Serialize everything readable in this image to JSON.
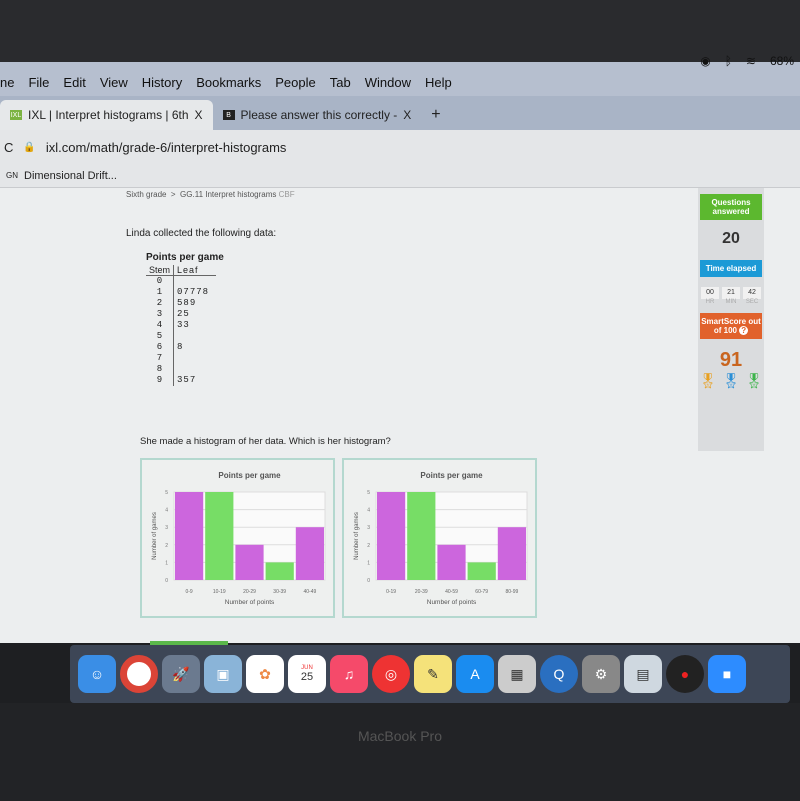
{
  "menubar": {
    "items": [
      "ne",
      "File",
      "Edit",
      "View",
      "History",
      "Bookmarks",
      "People",
      "Tab",
      "Window",
      "Help"
    ],
    "battery": "68%"
  },
  "tabs": [
    {
      "label": "IXL | Interpret histograms | 6th",
      "close": "X",
      "favicon": "IXL"
    },
    {
      "label": "Please answer this correctly -",
      "close": "X",
      "favicon": "B"
    }
  ],
  "new_tab": "+",
  "address": {
    "url": "ixl.com/math/grade-6/interpret-histograms"
  },
  "bookmarks": [
    {
      "label": "Dimensional Drift..."
    }
  ],
  "breadcrumb": {
    "grade": "Sixth grade",
    "sep": ">",
    "skill": "GG.11 Interpret histograms",
    "code": "CBF"
  },
  "question": {
    "intro": "Linda collected the following data:",
    "table_title": "Points per game",
    "headers": [
      "Stem",
      "Leaf"
    ],
    "rows": [
      [
        "0",
        ""
      ],
      [
        "1",
        "07778"
      ],
      [
        "2",
        "589"
      ],
      [
        "3",
        "25"
      ],
      [
        "4",
        "33"
      ],
      [
        "5",
        ""
      ],
      [
        "6",
        "8"
      ],
      [
        "7",
        ""
      ],
      [
        "8",
        ""
      ],
      [
        "9",
        "357"
      ]
    ],
    "prompt": "She made a histogram of her data. Which is her histogram?"
  },
  "sidebar": {
    "questions_label": "Questions answered",
    "questions": "20",
    "time_label": "Time elapsed",
    "hr": "00",
    "min": "21",
    "sec": "42",
    "hr_u": "HR",
    "min_u": "MIN",
    "sec_u": "SEC",
    "smartscore_label": "SmartScore out of 100",
    "help": "?",
    "score": "91",
    "colors": {
      "questions": "#5cb82f",
      "time": "#1c9ad6",
      "smartscore": "#e1622c"
    }
  },
  "dock": {
    "calendar_month": "JUN",
    "calendar_day": "25"
  },
  "laptop_label": "MacBook Pro",
  "chart_data": [
    {
      "type": "bar",
      "title": "Points per game",
      "xlabel": "Number of points",
      "ylabel": "Number of games",
      "categories": [
        "0-9",
        "10-19",
        "20-29",
        "30-39",
        "40-49"
      ],
      "values": [
        5,
        5,
        2,
        1,
        3
      ],
      "ylim": [
        0,
        5
      ],
      "yticks": [
        "0",
        "1",
        "2",
        "3",
        "4",
        "5"
      ],
      "grid": true,
      "colors": [
        "#cc66dd",
        "#77dd66",
        "#cc66dd",
        "#77dd66",
        "#cc66dd"
      ]
    },
    {
      "type": "bar",
      "title": "Points per game",
      "xlabel": "Number of points",
      "ylabel": "Number of games",
      "categories": [
        "0-19",
        "20-39",
        "40-59",
        "60-79",
        "80-99"
      ],
      "values": [
        5,
        5,
        2,
        1,
        3
      ],
      "ylim": [
        0,
        5
      ],
      "yticks": [
        "0",
        "1",
        "2",
        "3",
        "4",
        "5"
      ],
      "grid": true,
      "colors": [
        "#cc66dd",
        "#77dd66",
        "#cc66dd",
        "#77dd66",
        "#cc66dd"
      ]
    }
  ]
}
